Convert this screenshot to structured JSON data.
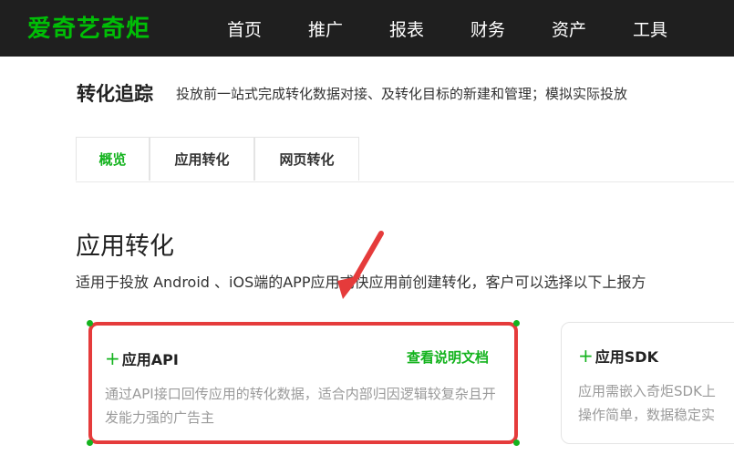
{
  "header": {
    "logo": "爱奇艺奇炬",
    "nav": [
      "首页",
      "推广",
      "报表",
      "财务",
      "资产",
      "工具"
    ]
  },
  "page": {
    "title": "转化追踪",
    "description": "投放前一站式完成转化数据对接、及转化目标的新建和管理；模拟实际投放"
  },
  "tabs": [
    {
      "label": "概览",
      "active": true
    },
    {
      "label": "应用转化",
      "active": false
    },
    {
      "label": "网页转化",
      "active": false
    }
  ],
  "section": {
    "title": "应用转化",
    "description": "适用于投放 Android 、iOS端的APP应用或快应用前创建转化，客户可以选择以下上报方"
  },
  "cards": [
    {
      "plus": "+",
      "title": "应用API",
      "link": "查看说明文档",
      "description": "通过API接口回传应用的转化数据，适合内部归因逻辑较复杂且开发能力强的广告主"
    },
    {
      "plus": "+",
      "title": "应用SDK",
      "description_lines": [
        "应用需嵌入奇炬SDK上",
        "操作简单，数据稳定实"
      ]
    }
  ],
  "colors": {
    "brand": "#14b31e",
    "highlight": "#e53b3b",
    "nav_bg": "#1f1f1f"
  }
}
